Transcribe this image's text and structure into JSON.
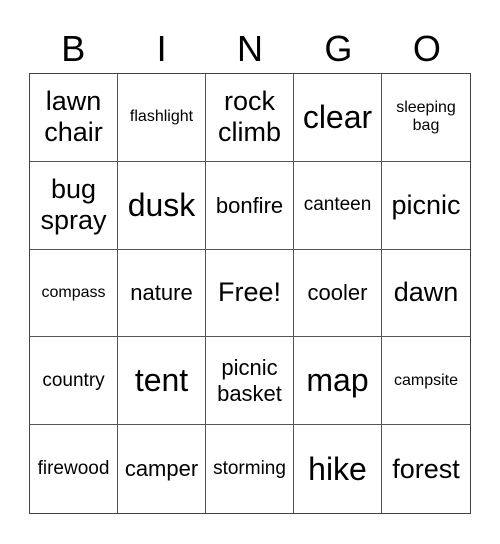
{
  "header": [
    "B",
    "I",
    "N",
    "G",
    "O"
  ],
  "cells": [
    "lawn chair",
    "flashlight",
    "rock climb",
    "clear",
    "sleeping bag",
    "bug spray",
    "dusk",
    "bonfire",
    "canteen",
    "picnic",
    "compass",
    "nature",
    "Free!",
    "cooler",
    "dawn",
    "country",
    "tent",
    "picnic basket",
    "map",
    "campsite",
    "firewood",
    "camper",
    "storming",
    "hike",
    "forest"
  ]
}
